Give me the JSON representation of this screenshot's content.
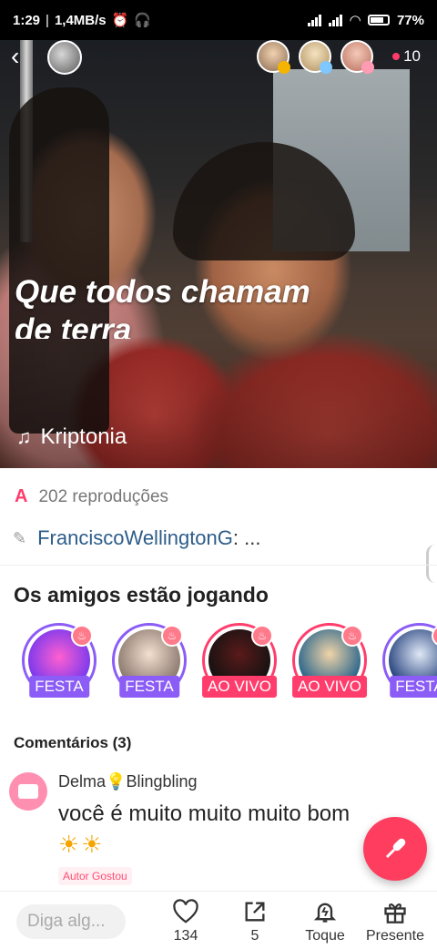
{
  "status_bar": {
    "time": "1:29",
    "speed": "1,4MB/s",
    "battery": "77"
  },
  "header": {
    "viewer_count": "10"
  },
  "hero": {
    "lyrics_line1": "Que todos chamam",
    "lyrics_line2": "de terra",
    "song_title": "Kriptonia"
  },
  "info": {
    "plays_icon": "A",
    "plays_text": "202 reproduções",
    "singer_name": "FranciscoWellingtonG",
    "singer_suffix": ": ..."
  },
  "friends": {
    "title": "Os amigos estão jogando",
    "items": [
      {
        "tag": "FESTA",
        "kind": "party"
      },
      {
        "tag": "FESTA",
        "kind": "party"
      },
      {
        "tag": "AO VIVO",
        "kind": "live"
      },
      {
        "tag": "AO VIVO",
        "kind": "live"
      },
      {
        "tag": "FESTA",
        "kind": "party"
      }
    ]
  },
  "comments": {
    "title": "Comentários (3)",
    "items": [
      {
        "user_first": "Delma",
        "user_icon": "lightbulb-icon",
        "user_rest": "Blingbling",
        "text": "você é muito muito muito bom",
        "suns": "☀☀",
        "badge": "Autor Gostou"
      }
    ]
  },
  "bottom_bar": {
    "input_placeholder": "Diga alg...",
    "like_count": "134",
    "share_count": "5",
    "touch_label": "Toque",
    "gift_label": "Presente"
  },
  "colors": {
    "accent": "#ff3d6c",
    "party": "#8b5cf6",
    "link": "#2d5d8a"
  }
}
